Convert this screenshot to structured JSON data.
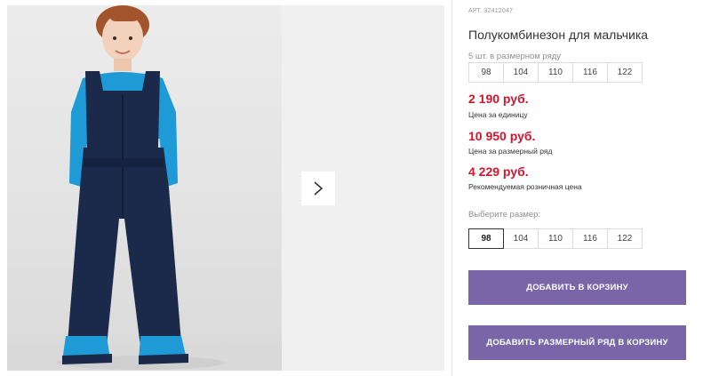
{
  "product": {
    "article": "АРТ. 32412047",
    "title": "Полукомбинезон для мальчика",
    "pack_note": "5 шт. в размерном ряду",
    "pack_sizes": [
      "98",
      "104",
      "110",
      "116",
      "122"
    ],
    "prices": [
      {
        "value": "2 190 руб.",
        "label": "Цена за единицу"
      },
      {
        "value": "10 950 руб.",
        "label": "Цена за размерный ряд"
      },
      {
        "value": "4 229 руб.",
        "label": "Рекомендуемая розничная цена"
      }
    ],
    "choose_label": "Выберите размер:",
    "size_options": [
      "98",
      "104",
      "110",
      "116",
      "122"
    ],
    "selected_size": "98",
    "add_to_cart": "ДОБАВИТЬ В КОРЗИНУ",
    "add_pack_to_cart": "ДОБАВИТЬ РАЗМЕРНЫЙ РЯД В КОРЗИНУ"
  },
  "colors": {
    "price": "#d2142d",
    "button": "#7a65a8",
    "overalls": "#1b2a4a",
    "shirt": "#1e9ad6"
  },
  "icons": {
    "next": "chevron-right-icon"
  }
}
